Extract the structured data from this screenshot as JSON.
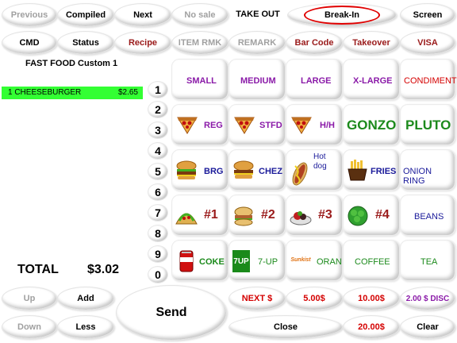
{
  "top_row": {
    "previous": "Previous",
    "compiled": "Compiled",
    "next": "Next",
    "no_sale": "No sale",
    "take_out": "TAKE OUT",
    "break_in": "Break-In",
    "screen": "Screen"
  },
  "second_row": {
    "cmd": "CMD",
    "status": "Status",
    "recipe": "Recipe",
    "item_rmk": "ITEM RMK",
    "remark": "REMARK",
    "bar_code": "Bar Code",
    "takeover": "Takeover",
    "visa": "VISA"
  },
  "order": {
    "header": "FAST FOOD  Custom 1",
    "items": [
      {
        "name": "1 CHEESEBURGER",
        "price": "$2.65"
      }
    ],
    "total_label": "TOTAL",
    "total_value": "$3.02"
  },
  "keypad": [
    "1",
    "2",
    "3",
    "4",
    "5",
    "6",
    "7",
    "8",
    "9",
    "0"
  ],
  "sizes": {
    "small": "SMALL",
    "medium": "MEDIUM",
    "large": "LARGE",
    "xlarge": "X-LARGE",
    "condiment": "CONDIMENT"
  },
  "pizza_row": {
    "reg": "REG",
    "stfd": "STFD",
    "hh": "H/H",
    "gonzo": "GONZO",
    "pluto": "PLUTO"
  },
  "food_row": {
    "brg": "BRG",
    "chez": "CHEZ",
    "hotdog": "Hot dog",
    "fries": "FRIES",
    "onion": "ONION RING"
  },
  "combo_row": {
    "c1": "#1",
    "c2": "#2",
    "c3": "#3",
    "c4": "#4",
    "beans": "BEANS"
  },
  "drink_row": {
    "coke": "COKE",
    "sevenup": "7-UP",
    "oran": "ORAN",
    "coffee": "COFFEE",
    "tea": "TEA"
  },
  "bottom": {
    "up": "Up",
    "add": "Add",
    "send": "Send",
    "down": "Down",
    "less": "Less",
    "next5": "NEXT $",
    "five": "5.00$",
    "ten": "10.00$",
    "disc": "2.00 $ DISC",
    "close": "Close",
    "twenty": "20.00$",
    "clear": "Clear"
  },
  "icon_text": {
    "sevenup": "7UP",
    "sunkist": "Sunkist"
  },
  "colors": {
    "highlight_green": "#33ff33",
    "accent_red": "#d40000",
    "accent_purple": "#8a1aa8",
    "accent_green": "#1c8a1c",
    "accent_blue": "#1a1a9a"
  }
}
